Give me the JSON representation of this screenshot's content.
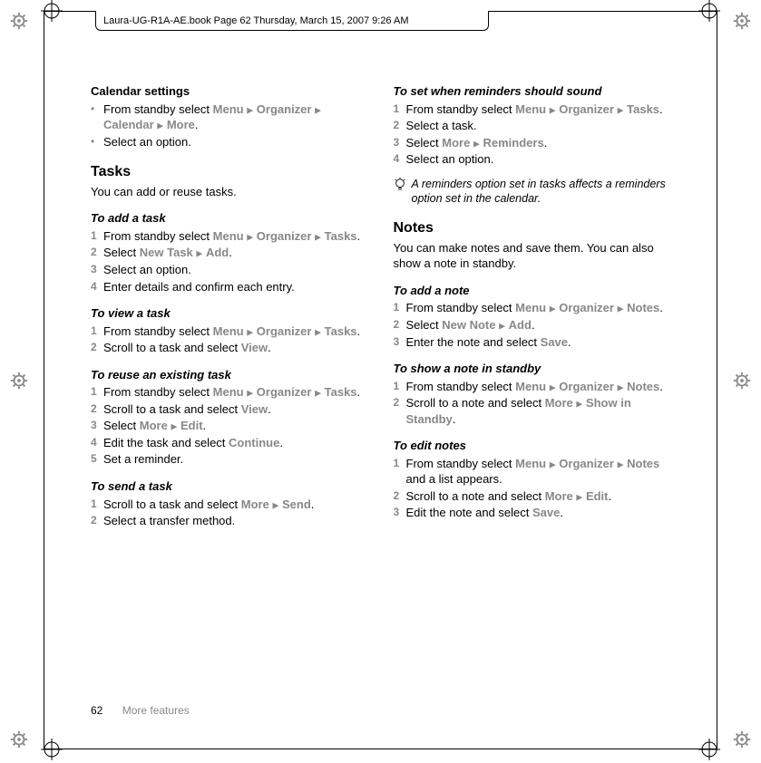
{
  "header": {
    "text": "Laura-UG-R1A-AE.book  Page 62  Thursday, March 15, 2007  9:26 AM"
  },
  "footer": {
    "page": "62",
    "section": "More features"
  },
  "left": {
    "calendar_settings_title": "Calendar settings",
    "cs_bullets": [
      {
        "pre": "From standby select ",
        "menu": "Menu ▸ Organizer ▸ Calendar ▸ More",
        "post": "."
      },
      {
        "pre": "Select an option.",
        "menu": "",
        "post": ""
      }
    ],
    "tasks_title": "Tasks",
    "tasks_intro": "You can add or reuse tasks.",
    "add_task_title": "To add a task",
    "add_task_steps": [
      {
        "pre": "From standby select ",
        "menu": "Menu ▸ Organizer ▸ Tasks",
        "post": "."
      },
      {
        "pre": "Select ",
        "menu": "New Task ▸ Add",
        "post": "."
      },
      {
        "pre": "Select an option.",
        "menu": "",
        "post": ""
      },
      {
        "pre": "Enter details and confirm each entry.",
        "menu": "",
        "post": ""
      }
    ],
    "view_task_title": "To view a task",
    "view_task_steps": [
      {
        "pre": "From standby select ",
        "menu": "Menu ▸ Organizer ▸ Tasks",
        "post": "."
      },
      {
        "pre": "Scroll to a task and select ",
        "menu": "View",
        "post": "."
      }
    ],
    "reuse_task_title": "To reuse an existing task",
    "reuse_task_steps": [
      {
        "pre": "From standby select ",
        "menu": "Menu ▸ Organizer ▸ Tasks",
        "post": "."
      },
      {
        "pre": "Scroll to a task and select ",
        "menu": "View",
        "post": "."
      },
      {
        "pre": "Select ",
        "menu": "More ▸ Edit",
        "post": "."
      },
      {
        "pre": "Edit the task and select ",
        "menu": "Continue",
        "post": "."
      },
      {
        "pre": "Set a reminder.",
        "menu": "",
        "post": ""
      }
    ],
    "send_task_title": "To send a task",
    "send_task_steps": [
      {
        "pre": "Scroll to a task and select ",
        "menu": "More ▸ Send",
        "post": "."
      },
      {
        "pre": "Select a transfer method.",
        "menu": "",
        "post": ""
      }
    ]
  },
  "right": {
    "reminders_title": "To set when reminders should sound",
    "reminders_steps": [
      {
        "pre": "From standby select ",
        "menu": "Menu ▸ Organizer ▸ Tasks",
        "post": "."
      },
      {
        "pre": "Select a task.",
        "menu": "",
        "post": ""
      },
      {
        "pre": "Select ",
        "menu": "More ▸ Reminders",
        "post": "."
      },
      {
        "pre": "Select an option.",
        "menu": "",
        "post": ""
      }
    ],
    "tip": "A reminders option set in tasks affects a reminders option set in the calendar.",
    "notes_title": "Notes",
    "notes_intro": "You can make notes and save them. You can also show a note in standby.",
    "add_note_title": "To add a note",
    "add_note_steps": [
      {
        "pre": "From standby select ",
        "menu": "Menu ▸ Organizer ▸ Notes",
        "post": "."
      },
      {
        "pre": "Select ",
        "menu": "New Note ▸ Add",
        "post": "."
      },
      {
        "pre": "Enter the note and select ",
        "menu": "Save",
        "post": "."
      }
    ],
    "show_note_title": "To show a note in standby",
    "show_note_steps": [
      {
        "pre": "From standby select ",
        "menu": "Menu ▸ Organizer ▸ Notes",
        "post": "."
      },
      {
        "pre": "Scroll to a note and select ",
        "menu": "More ▸ Show in Standby",
        "post": "."
      }
    ],
    "edit_notes_title": "To edit notes",
    "edit_notes_steps": [
      {
        "pre": "From standby select ",
        "menu": "Menu ▸ Organizer ▸ Notes",
        "post": " and a list appears."
      },
      {
        "pre": "Scroll to a note and select ",
        "menu": "More ▸ Edit",
        "post": "."
      },
      {
        "pre": "Edit the note and select ",
        "menu": "Save",
        "post": "."
      }
    ]
  }
}
